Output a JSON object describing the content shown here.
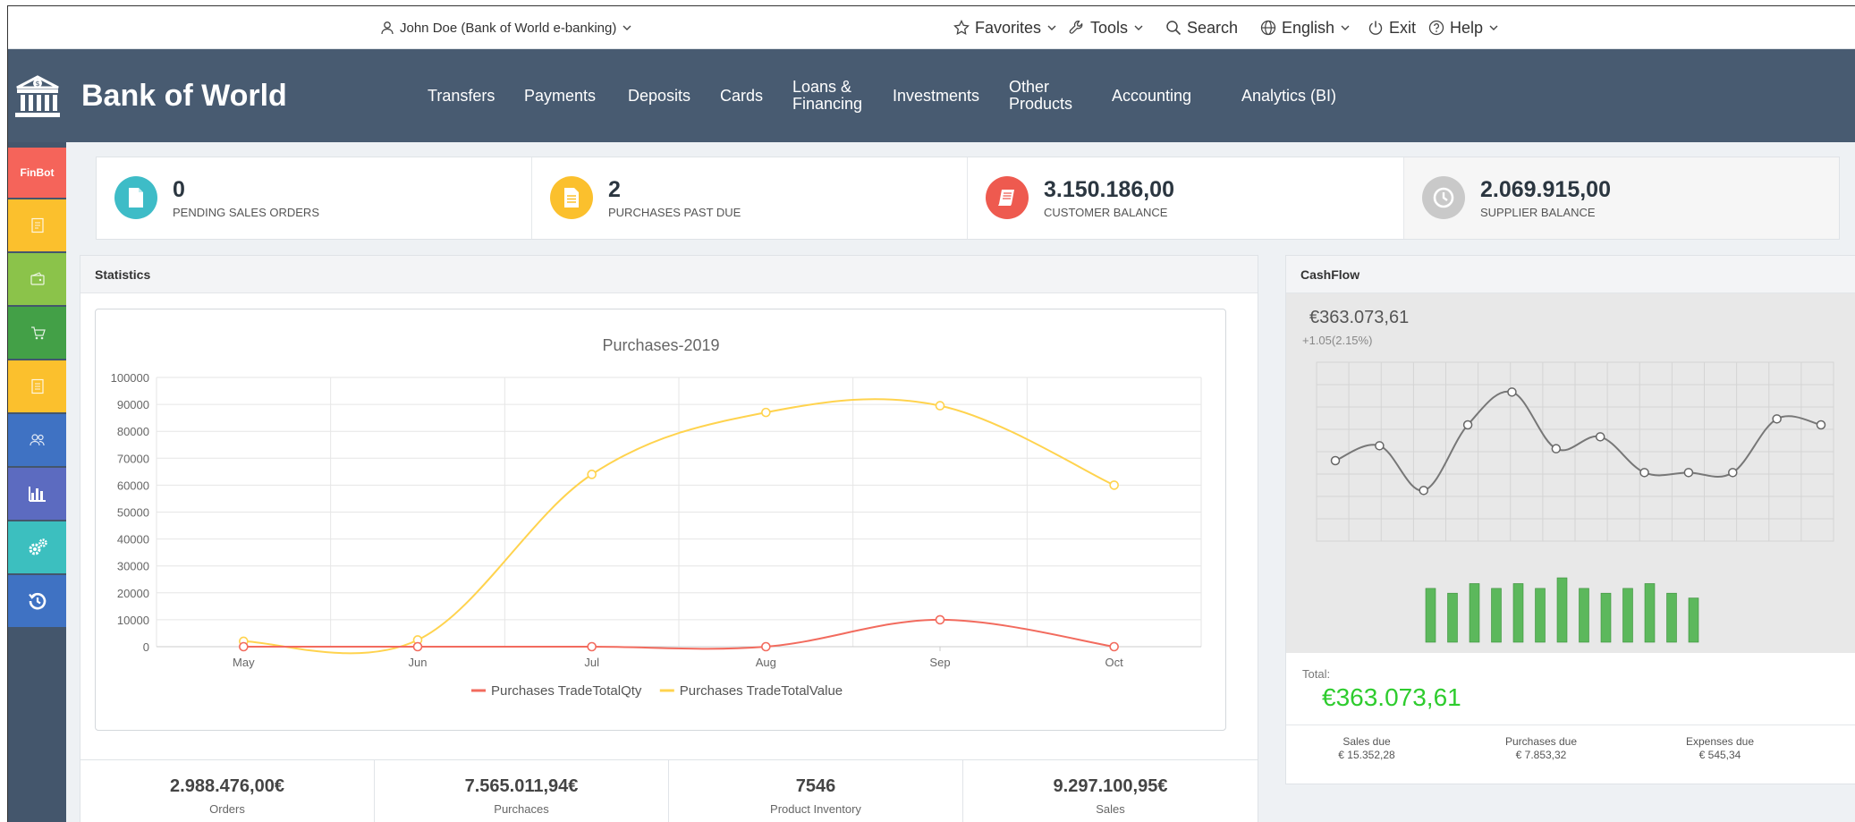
{
  "topbar": {
    "user": "John Doe (Bank of World e-banking)",
    "favorites": "Favorites",
    "tools": "Tools",
    "search": "Search",
    "language": "English",
    "exit": "Exit",
    "help": "Help"
  },
  "brand": {
    "name": "Bank of World"
  },
  "nav": [
    {
      "label": "Transfers"
    },
    {
      "label": "Payments"
    },
    {
      "label": "Deposits"
    },
    {
      "label": "Cards"
    },
    {
      "label": "Loans & Financing"
    },
    {
      "label": "Investments"
    },
    {
      "label": "Other Products"
    },
    {
      "label": "Accounting"
    },
    {
      "label": "Analytics (BI)"
    }
  ],
  "sidebar": {
    "finbot": "FinBot",
    "items": [
      {
        "icon": "document-icon",
        "color": "#fbc02d"
      },
      {
        "icon": "wallet-icon",
        "color": "#8bc34a"
      },
      {
        "icon": "cart-icon",
        "color": "#43a047"
      },
      {
        "icon": "invoice-icon",
        "color": "#fbc02d"
      },
      {
        "icon": "users-icon",
        "color": "#3f72c3"
      },
      {
        "icon": "bar-chart-icon",
        "color": "#5c6bc0"
      },
      {
        "icon": "gears-icon",
        "color": "#3cbfbf"
      },
      {
        "icon": "history-icon",
        "color": "#3f72c3"
      }
    ],
    "finbot_color": "#f5645a"
  },
  "kpis": [
    {
      "value": "0",
      "label": "PENDING SALES ORDERS",
      "icon": "file-icon",
      "color": "#3ebcc7"
    },
    {
      "value": "2",
      "label": "PURCHASES PAST DUE",
      "icon": "list-file-icon",
      "color": "#fbc02d"
    },
    {
      "value": "3.150.186,00",
      "label": "CUSTOMER BALANCE",
      "icon": "book-icon",
      "color": "#ee5a4f"
    },
    {
      "value": "2.069.915,00",
      "label": "SUPPLIER BALANCE",
      "icon": "clock-icon",
      "color": "#c9c9c9"
    }
  ],
  "statistics": {
    "title": "Statistics"
  },
  "chart_data": {
    "type": "line",
    "title": "Purchases-2019",
    "categories": [
      "May",
      "Jun",
      "Jul",
      "Aug",
      "Sep",
      "Oct"
    ],
    "yticks": [
      "100000",
      "90000",
      "80000",
      "70000",
      "60000",
      "50000",
      "40000",
      "30000",
      "20000",
      "10000",
      "0"
    ],
    "ylim": [
      0,
      100000
    ],
    "grid": true,
    "legend": "bottom",
    "series": [
      {
        "name": "Purchases TradeTotalQty",
        "color": "#f26b5e",
        "values": [
          0,
          0,
          0,
          0,
          10000,
          0
        ]
      },
      {
        "name": "Purchases TradeTotalValue",
        "color": "#ffd34e",
        "values": [
          2000,
          2500,
          64000,
          87000,
          89500,
          60000
        ]
      }
    ]
  },
  "summary": [
    {
      "value": "2.988.476,00€",
      "label": "Orders"
    },
    {
      "value": "7.565.011,94€",
      "label": "Purchaces"
    },
    {
      "value": "7546",
      "label": "Product Inventory"
    },
    {
      "value": "9.297.100,95€",
      "label": "Sales"
    }
  ],
  "cashflow": {
    "title": "CashFlow",
    "amount": "€363.073,61",
    "change": "+1.05(2.15%)",
    "line_values": [
      57,
      62,
      47,
      69,
      80,
      61,
      65,
      53,
      53,
      53,
      71,
      69
    ],
    "bar_values": [
      56,
      51,
      61,
      56,
      61,
      56,
      67,
      56,
      51,
      56,
      61,
      51,
      46
    ],
    "total_label": "Total:",
    "total_value": "€363.073,61",
    "dues": [
      {
        "label": "Sales due",
        "value": "€ 15.352,28"
      },
      {
        "label": "Purchases due",
        "value": "€ 7.853,32"
      },
      {
        "label": "Expenses due",
        "value": "€ 545,34"
      }
    ],
    "colors": {
      "line": "#777777",
      "bars": "#5cb85c",
      "total": "#2ecc2e"
    }
  }
}
